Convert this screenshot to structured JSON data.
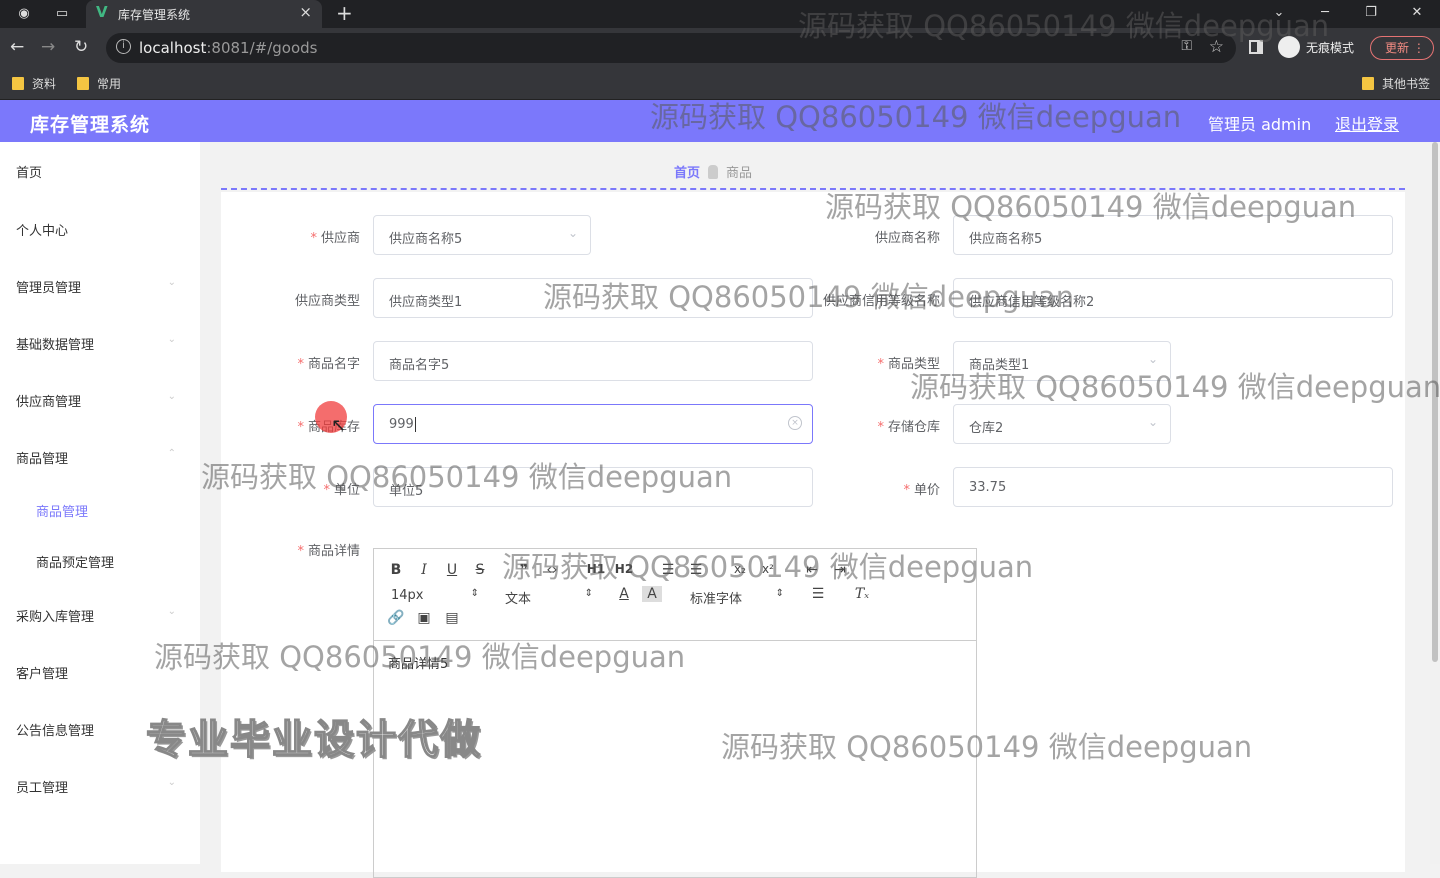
{
  "browser": {
    "tab_title": "库存管理系统",
    "url_host": "localhost",
    "url_rest": ":8081/#/goods",
    "incognito_label": "无痕模式",
    "update_label": "更新",
    "bookmarks": [
      "资料",
      "常用"
    ],
    "other_bookmarks": "其他书签"
  },
  "header": {
    "brand": "库存管理系统",
    "user": "管理员 admin",
    "logout": "退出登录",
    "color": "#7b78fb"
  },
  "sidebar": {
    "items": [
      "首页",
      "个人中心",
      "管理员管理",
      "基础数据管理",
      "供应商管理",
      "商品管理",
      "采购入库管理",
      "客户管理",
      "公告信息管理",
      "员工管理"
    ],
    "sub_items": [
      "商品管理",
      "商品预定管理"
    ]
  },
  "breadcrumb": {
    "home": "首页",
    "current": "商品"
  },
  "form": {
    "supplier": {
      "label": "供应商",
      "value": "供应商名称5"
    },
    "supplier_name": {
      "label": "供应商名称",
      "value": "供应商名称5"
    },
    "supplier_type": {
      "label": "供应商类型",
      "value": "供应商类型1"
    },
    "supplier_credit": {
      "label": "供应商信用等级名称",
      "value": "供应商信用等级名称2"
    },
    "goods_name": {
      "label": "商品名字",
      "value": "商品名字5"
    },
    "goods_type": {
      "label": "商品类型",
      "value": "商品类型1"
    },
    "goods_stock": {
      "label": "商品库存",
      "value": "999"
    },
    "warehouse": {
      "label": "存储仓库",
      "value": "仓库2"
    },
    "unit": {
      "label": "单位",
      "value": "单位5"
    },
    "price": {
      "label": "单价",
      "value": "33.75"
    },
    "detail": {
      "label": "商品详情",
      "value": "商品详情5"
    }
  },
  "editor": {
    "font_size": "14px",
    "header_select": "文本",
    "font_family": "标准字体"
  },
  "watermark": "源码获取 QQ86050149 微信deepguan",
  "promo": "专业毕业设计代做"
}
